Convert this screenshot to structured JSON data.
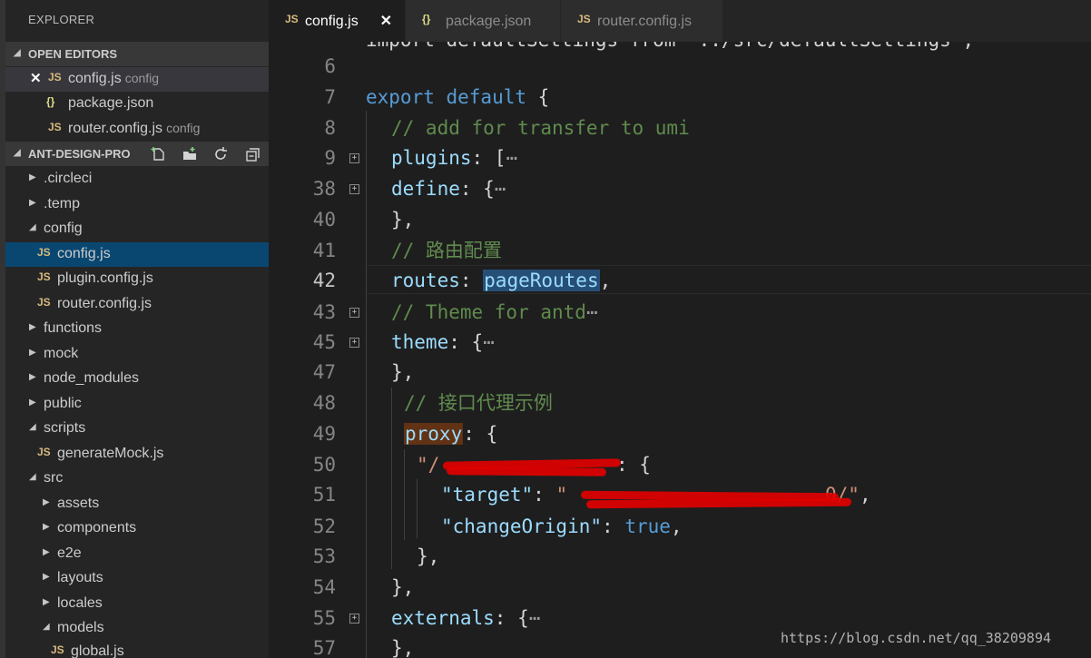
{
  "explorer": {
    "title": "EXPLORER",
    "open_editors": {
      "label": "OPEN EDITORS",
      "items": [
        {
          "icon": "JS",
          "name": "config.js",
          "desc": "config"
        },
        {
          "icon": "{}",
          "name": "package.json",
          "desc": ""
        },
        {
          "icon": "JS",
          "name": "router.config.js",
          "desc": "config"
        }
      ]
    },
    "project": {
      "label": "ANT-DESIGN-PRO",
      "tree": [
        {
          "name": ".circleci",
          "twisty": "▶"
        },
        {
          "name": ".temp",
          "twisty": "▶"
        },
        {
          "name": "config",
          "twisty": "◢"
        },
        {
          "name": "config.js",
          "icon": "JS"
        },
        {
          "name": "plugin.config.js",
          "icon": "JS"
        },
        {
          "name": "router.config.js",
          "icon": "JS"
        },
        {
          "name": "functions",
          "twisty": "▶"
        },
        {
          "name": "mock",
          "twisty": "▶"
        },
        {
          "name": "node_modules",
          "twisty": "▶"
        },
        {
          "name": "public",
          "twisty": "▶"
        },
        {
          "name": "scripts",
          "twisty": "◢"
        },
        {
          "name": "generateMock.js",
          "icon": "JS"
        },
        {
          "name": "src",
          "twisty": "◢"
        },
        {
          "name": "assets",
          "twisty": "▶"
        },
        {
          "name": "components",
          "twisty": "▶"
        },
        {
          "name": "e2e",
          "twisty": "▶"
        },
        {
          "name": "layouts",
          "twisty": "▶"
        },
        {
          "name": "locales",
          "twisty": "▶"
        },
        {
          "name": "models",
          "twisty": "◢"
        },
        {
          "name": "global.js",
          "icon": "JS"
        }
      ]
    }
  },
  "tabs": [
    {
      "icon": "JS",
      "name": "config.js",
      "close": "✕"
    },
    {
      "icon": "{}",
      "name": "package.json"
    },
    {
      "icon": "JS",
      "name": "router.config.js"
    }
  ],
  "editor": {
    "line_numbers": [
      "6",
      "7",
      "8",
      "9",
      "38",
      "40",
      "41",
      "42",
      "43",
      "45",
      "47",
      "48",
      "49",
      "50",
      "51",
      "52",
      "53",
      "54",
      "55",
      "57"
    ],
    "fold_marker": "+",
    "ellipsis": "⋯",
    "lines": {
      "top_partial": "import defaultSettings from '../src/defaultSettings';",
      "l7_kw": "export default",
      "l7_rest": " {",
      "l8": "// add for transfer to umi",
      "l9_prop": "plugins",
      "l9_rest": ": [",
      "l38_prop": "define",
      "l38_rest": ": {",
      "l40": "},",
      "l41": "// 路由配置",
      "l42_prop": "routes",
      "l42_colon": ": ",
      "l42_value": "pageRoutes",
      "l42_rest": ",",
      "l43": "// Theme for antd",
      "l45_prop": "theme",
      "l45_rest": ": {",
      "l47": "},",
      "l48": "// 接口代理示例",
      "l49_prop": "proxy",
      "l49_rest": ": {",
      "l50_str": "\"/",
      "l50_rest": ": {",
      "l51_key": "\"target\"",
      "l51_colon": ": ",
      "l51_str_open": "\"",
      "l51_str_tail": "0/\"",
      "l51_rest": ",",
      "l52_key": "\"changeOrigin\"",
      "l52_colon": ": ",
      "l52_bool": "true",
      "l52_rest": ",",
      "l53": "},",
      "l54": "},",
      "l55_prop": "externals",
      "l55_rest": ": {",
      "l57": "},"
    }
  },
  "watermark": "https://blog.csdn.net/qq_38209894",
  "colors": {
    "selection": "#094771",
    "keyword": "#569cd6",
    "comment": "#608b4e",
    "property": "#9cdcfe",
    "string": "#ce9178",
    "redaction": "#e00000"
  }
}
